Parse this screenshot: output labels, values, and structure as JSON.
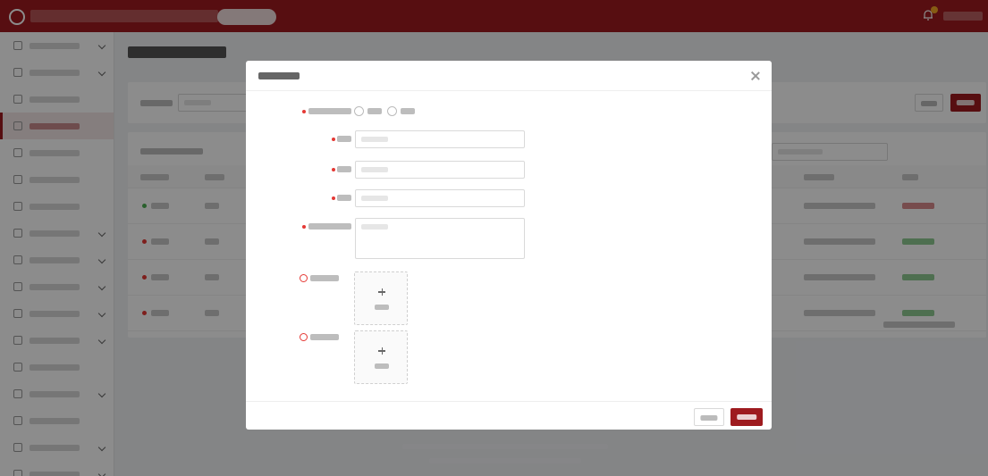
{
  "colors": {
    "brand": "#9e1b1f",
    "active_bg": "#f3e6e6",
    "urgent": "#e53935",
    "normal": "#4caf50",
    "pending": "#f5a623"
  },
  "icons": {
    "logo": "university-seal-icon",
    "bell": "bell-icon",
    "close": "close-icon",
    "plus": "plus-icon",
    "warn": "warning-circle-icon",
    "chevron": "chevron-down-icon"
  },
  "sidebar": {
    "item_count": 17,
    "active_index": 3
  },
  "table": {
    "rows": [
      {
        "urgency": "normal"
      },
      {
        "urgency": "urgent"
      },
      {
        "urgency": "urgent"
      },
      {
        "urgency": "urgent"
      }
    ]
  },
  "modal": {
    "radio_options": 2,
    "text_fields": 3,
    "upload_slots": 2
  }
}
